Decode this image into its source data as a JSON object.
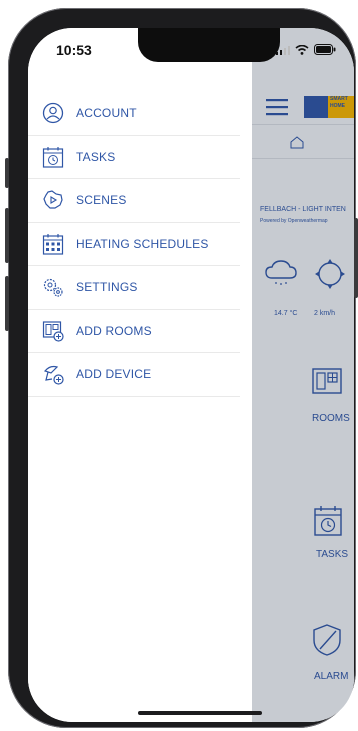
{
  "status": {
    "time": "10:53"
  },
  "menu": {
    "items": [
      {
        "label": "ACCOUNT",
        "icon": "account-icon"
      },
      {
        "label": "TASKS",
        "icon": "tasks-icon"
      },
      {
        "label": "SCENES",
        "icon": "scenes-icon"
      },
      {
        "label": "HEATING SCHEDULES",
        "icon": "heating-schedules-icon"
      },
      {
        "label": "SETTINGS",
        "icon": "settings-icon"
      },
      {
        "label": "ADD ROOMS",
        "icon": "add-rooms-icon"
      },
      {
        "label": "ADD DEVICE",
        "icon": "add-device-icon"
      }
    ]
  },
  "right_pane": {
    "logo_text": "SMART HOME",
    "weather": {
      "title": "FELLBACH - LIGHT INTEN",
      "subtitle": "Powered by Openweathermap",
      "temperature": "14.7 °C",
      "wind": "2 km/h"
    },
    "tiles": [
      {
        "label": "ROOMS",
        "icon": "rooms-icon"
      },
      {
        "label": "TASKS",
        "icon": "tasks-icon"
      },
      {
        "label": "ALARM",
        "icon": "alarm-icon"
      }
    ]
  },
  "colors": {
    "accent": "#2f56a6",
    "divider": "#e9e9e9",
    "right_pane_bg": "#eef2f6"
  }
}
